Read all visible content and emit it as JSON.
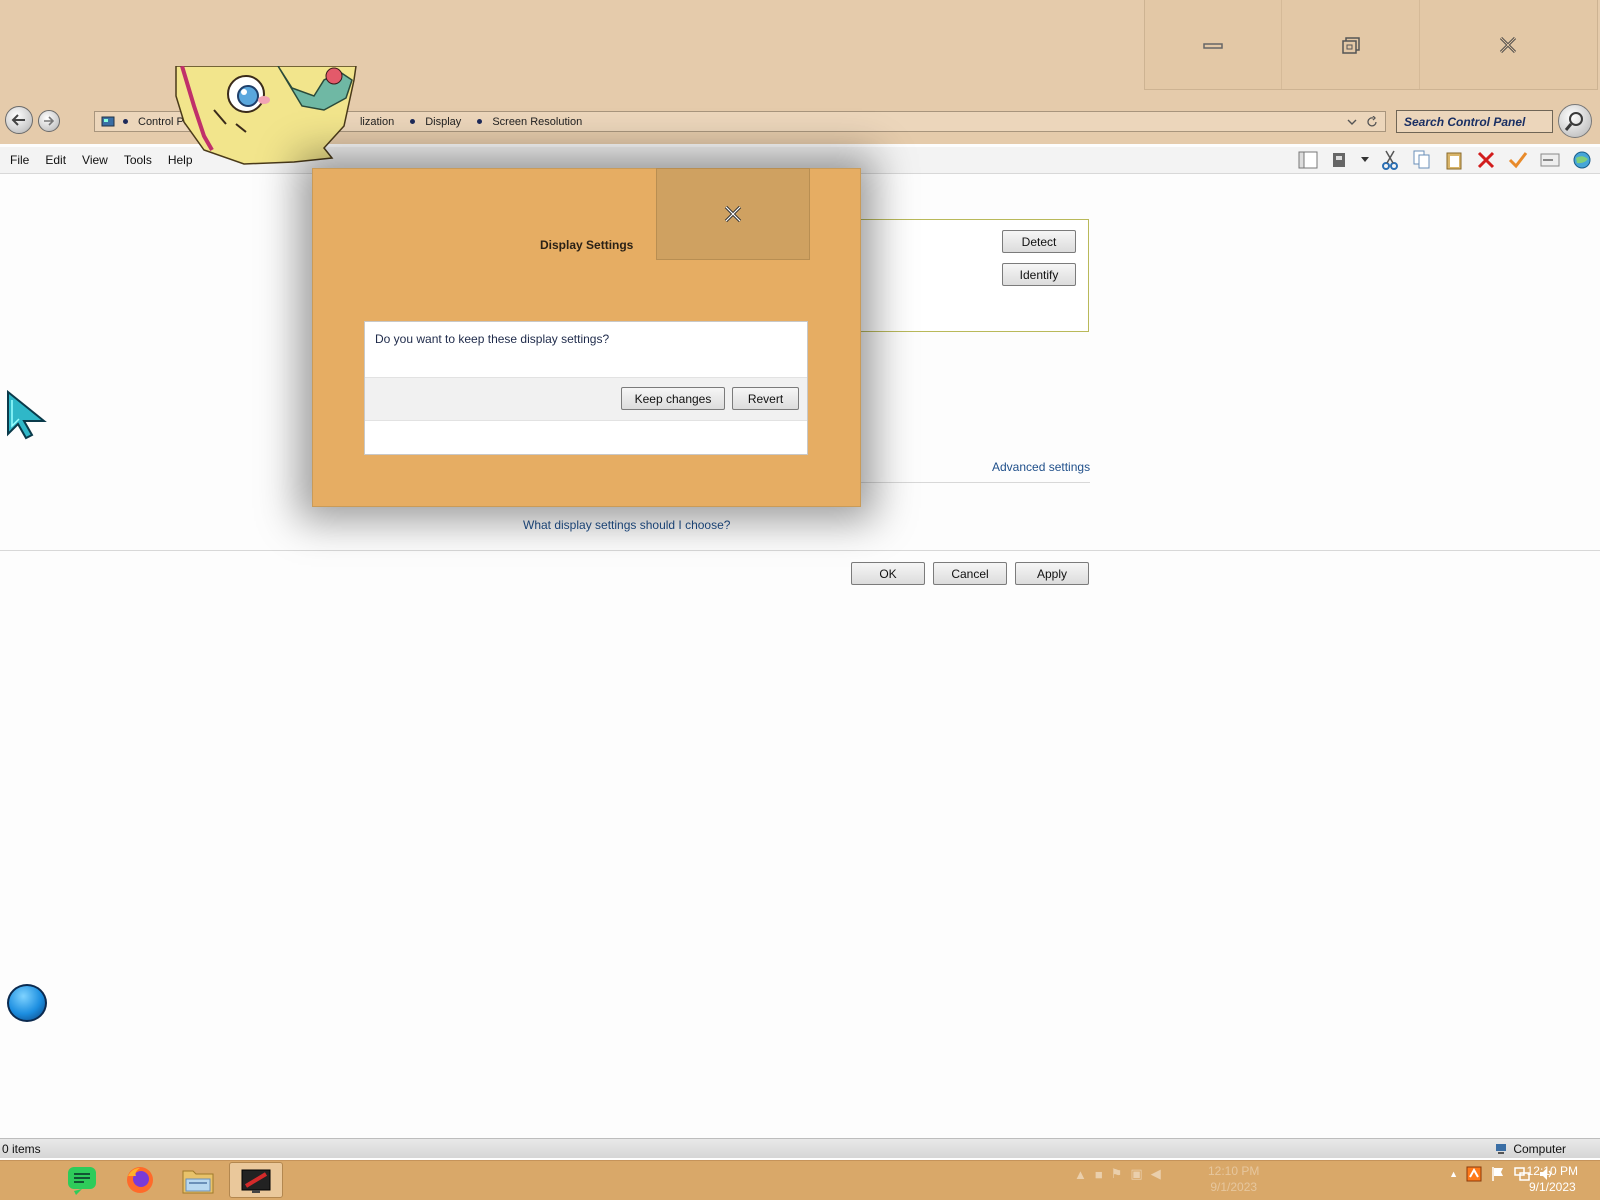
{
  "window": {
    "caption_buttons": [
      {
        "name": "minimize",
        "icon": "minimize-icon"
      },
      {
        "name": "restore",
        "icon": "restore-icon"
      },
      {
        "name": "close",
        "icon": "close-icon"
      }
    ]
  },
  "address_bar": {
    "crumbs": [
      "Control Pa",
      "lization",
      "Display",
      "Screen Resolution"
    ]
  },
  "search": {
    "placeholder": "Search Control Panel"
  },
  "menu": {
    "items": [
      "File",
      "Edit",
      "View",
      "Tools",
      "Help"
    ]
  },
  "monitor_panel": {
    "detect_label": "Detect",
    "identify_label": "Identify"
  },
  "links": {
    "advanced_settings": "Advanced settings",
    "help": "What display settings should I choose?"
  },
  "footer_buttons": {
    "ok": "OK",
    "cancel": "Cancel",
    "apply": "Apply"
  },
  "dialog": {
    "title": "Display Settings",
    "question": "Do you want to keep these display settings?",
    "keep_label": "Keep changes",
    "revert_label": "Revert"
  },
  "status_bar": {
    "items_count": "0 items",
    "location": "Computer"
  },
  "taskbar": {
    "apps": [
      "notes-app",
      "firefox",
      "file-explorer",
      "display-settings-app"
    ],
    "clock": {
      "time": "12:10 PM",
      "date": "9/1/2023"
    }
  },
  "colors": {
    "titlebar": "#e5cbab",
    "dialog_background": "#e6ad63",
    "taskbar": "#d9a869",
    "link": "#1f4f8a"
  }
}
